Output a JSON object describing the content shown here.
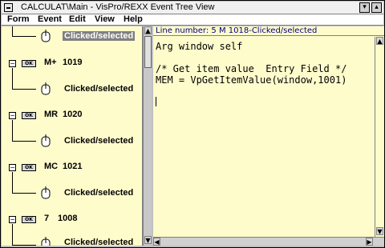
{
  "window": {
    "title": "CALCULAT\\Main - VisPro/REXX Event Tree View",
    "minimize_label": "▾",
    "maximize_label": "▴"
  },
  "menu": [
    {
      "label": "Form"
    },
    {
      "label": "Event"
    },
    {
      "label": "Edit"
    },
    {
      "label": "View"
    },
    {
      "label": "Help"
    }
  ],
  "tree": {
    "top_event": "Clicked/selected",
    "nodes": [
      {
        "name": "M+",
        "id": "1019",
        "event": "Clicked/selected"
      },
      {
        "name": "MR",
        "id": "1020",
        "event": "Clicked/selected"
      },
      {
        "name": "MC",
        "id": "1021",
        "event": "Clicked/selected"
      },
      {
        "name": "7",
        "id": "1008",
        "event": "Clicked/selected"
      }
    ],
    "collapse_glyph": "−",
    "button_icon_text": "OK"
  },
  "editor": {
    "header": "Line number: 5   M   1018-Clicked/selected",
    "lines": [
      "Arg window self",
      "",
      "/* Get item value  Entry Field */",
      "MEM = VpGetItemValue(window,1001)",
      ""
    ]
  },
  "icons": {
    "scroll_up": "▲",
    "scroll_down": "▼",
    "scroll_left": "◀",
    "scroll_right": "▶"
  }
}
